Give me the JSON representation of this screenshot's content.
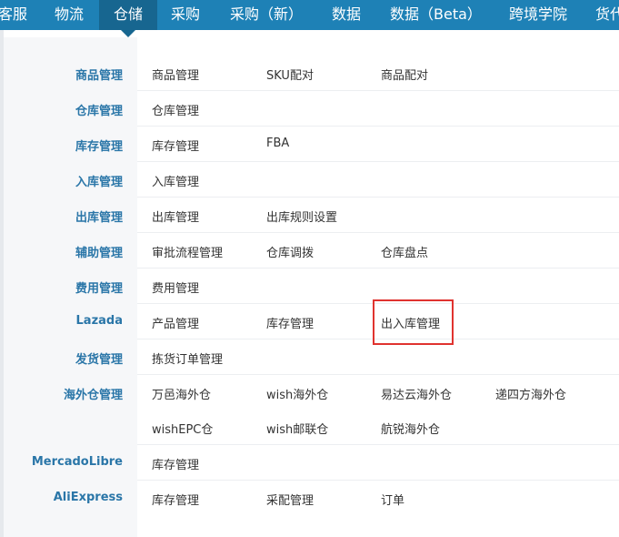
{
  "nav": [
    {
      "label": "客服"
    },
    {
      "label": "物流"
    },
    {
      "label": "仓储"
    },
    {
      "label": "采购"
    },
    {
      "label": "采购（新）"
    },
    {
      "label": "数据"
    },
    {
      "label": "数据（Beta）"
    },
    {
      "label": "跨境学院"
    },
    {
      "label": "货代"
    }
  ],
  "menu": [
    {
      "category": "商品管理",
      "items": [
        "商品管理",
        "SKU配对",
        "商品配对"
      ]
    },
    {
      "category": "仓库管理",
      "items": [
        "仓库管理"
      ]
    },
    {
      "category": "库存管理",
      "items": [
        "库存管理",
        "FBA"
      ]
    },
    {
      "category": "入库管理",
      "items": [
        "入库管理"
      ]
    },
    {
      "category": "出库管理",
      "items": [
        "出库管理",
        "出库规则设置"
      ]
    },
    {
      "category": "辅助管理",
      "items": [
        "审批流程管理",
        "仓库调拨",
        "仓库盘点"
      ]
    },
    {
      "category": "费用管理",
      "items": [
        "费用管理"
      ]
    },
    {
      "category": "Lazada",
      "items": [
        "产品管理",
        "库存管理",
        "出入库管理"
      ]
    },
    {
      "category": "发货管理",
      "items": [
        "拣货订单管理"
      ]
    },
    {
      "category": "海外仓管理",
      "items": [
        "万邑海外仓",
        "wish海外仓",
        "易达云海外仓",
        "递四方海外仓",
        "wishEPC仓",
        "wish邮联仓",
        "航锐海外仓"
      ]
    },
    {
      "category": "MercadoLibre",
      "items": [
        "库存管理"
      ]
    },
    {
      "category": "AliExpress",
      "items": [
        "库存管理",
        "采配管理",
        "订单"
      ]
    }
  ]
}
